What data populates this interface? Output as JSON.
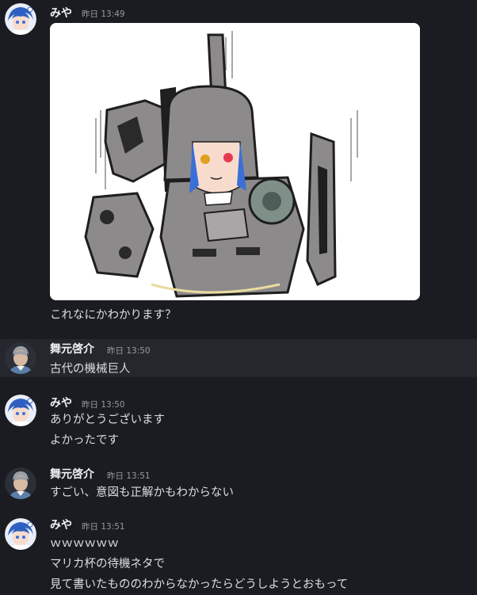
{
  "messages": [
    {
      "author": "みや",
      "timestamp": "昨日 13:49",
      "attachment": {
        "name": "mecha-girl-illustration"
      },
      "lines": [
        "これなにかわかります？"
      ]
    },
    {
      "author": "舞元啓介",
      "timestamp": "昨日 13:50",
      "lines": [
        "古代の機械巨人"
      ]
    },
    {
      "author": "みや",
      "timestamp": "昨日 13:50",
      "lines": [
        "ありがとうございます",
        "よかったです"
      ]
    },
    {
      "author": "舞元啓介",
      "timestamp": "昨日 13:51",
      "lines": [
        "すごい、意図も正解かもわからない"
      ]
    },
    {
      "author": "みや",
      "timestamp": "昨日 13:51",
      "lines": [
        "ｗｗｗｗｗｗ",
        "マリカ杯の待機ネタで",
        "見て書いたもののわからなかったらどうしようとおもって"
      ]
    }
  ],
  "colors": {
    "background": "#1b1c21",
    "hover_row": "#26272d",
    "text": "#dbdee1",
    "author": "#f2f3f5",
    "timestamp": "#949ba4",
    "miya_avatar_hair": "#2f5fc0",
    "maimoto_avatar_hair": "#9aa0a6"
  }
}
